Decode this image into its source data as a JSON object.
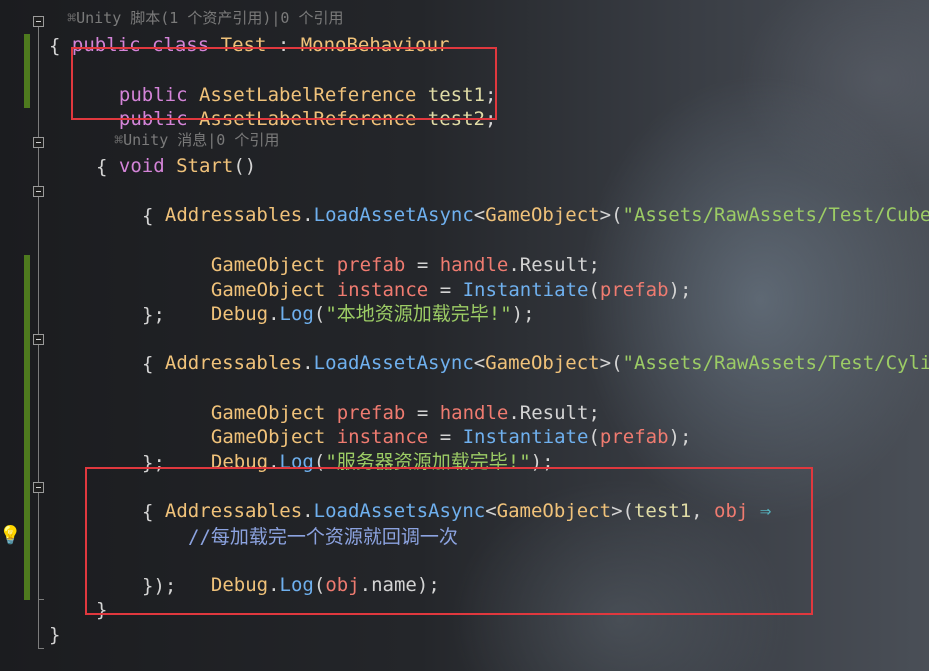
{
  "codelens": {
    "top": "Unity 脚本(1 个资产引用)|0 个引用",
    "start": "Unity 消息|0 个引用"
  },
  "code": {
    "l_class": {
      "kw1": "public",
      "kw2": "class",
      "name": "Test",
      "sep": " : ",
      "base": "MonoBehaviour"
    },
    "brace_open": "{",
    "field1": {
      "kw": "public",
      "type": "AssetLabelReference",
      "name": "test1",
      "end": ";"
    },
    "field2": {
      "kw": "public",
      "type": "AssetLabelReference",
      "name": "test2",
      "end": ";"
    },
    "start_sig": {
      "kw": "void",
      "name": "Start",
      "paren": "()"
    },
    "m_brace_open": "{",
    "load1": {
      "cls": "Addressables",
      "dot": ".",
      "method": "LoadAssetAsync",
      "gen_open": "<",
      "gen": "GameObject",
      "gen_close": ">(",
      "str": "\"Assets/RawAssets/Test/Cube."
    },
    "l1_open": "{",
    "l1_a": {
      "type": "GameObject",
      "var": "prefab",
      "eq": " = ",
      "handle": "handle",
      "dot": ".",
      "prop": "Result",
      "end": ";"
    },
    "l1_b": {
      "type": "GameObject",
      "var": "instance",
      "eq": " = ",
      "method": "Instantiate",
      "p1": "(",
      "arg": "prefab",
      "p2": ");"
    },
    "l1_c": {
      "cls": "Debug",
      "dot": ".",
      "method": "Log",
      "p1": "(",
      "str": "\"本地资源加载完毕!\"",
      "p2": ");"
    },
    "l1_close": "};",
    "load2": {
      "cls": "Addressables",
      "dot": ".",
      "method": "LoadAssetAsync",
      "gen_open": "<",
      "gen": "GameObject",
      "gen_close": ">(",
      "str": "\"Assets/RawAssets/Test/Cylin"
    },
    "l2_open": "{",
    "l2_a": {
      "type": "GameObject",
      "var": "prefab",
      "eq": " = ",
      "handle": "handle",
      "dot": ".",
      "prop": "Result",
      "end": ";"
    },
    "l2_b": {
      "type": "GameObject",
      "var": "instance",
      "eq": " = ",
      "method": "Instantiate",
      "p1": "(",
      "arg": "prefab",
      "p2": ");"
    },
    "l2_c": {
      "cls": "Debug",
      "dot": ".",
      "method": "Log",
      "p1": "(",
      "str": "\"服务器资源加载完毕!\"",
      "p2": ");"
    },
    "l2_close": "};",
    "load3": {
      "cls": "Addressables",
      "dot": ".",
      "method": "LoadAssetsAsync",
      "gen_open": "<",
      "gen": "GameObject",
      "gen_close": ">(",
      "arg": "test1",
      "comma": ", ",
      "param": "obj",
      "arrow": " ⇒"
    },
    "l3_open": "{",
    "l3_comment": "//每加载完一个资源就回调一次",
    "l3_log": {
      "cls": "Debug",
      "dot": ".",
      "method": "Log",
      "p1": "(",
      "obj": "obj",
      "dot2": ".",
      "prop": "name",
      "p2": ");"
    },
    "l3_close": "});",
    "m_brace_close": "}",
    "brace_close": "}"
  },
  "colors": {
    "highlight_box": "#e0383e",
    "change_bar": "#4e7a1e"
  }
}
